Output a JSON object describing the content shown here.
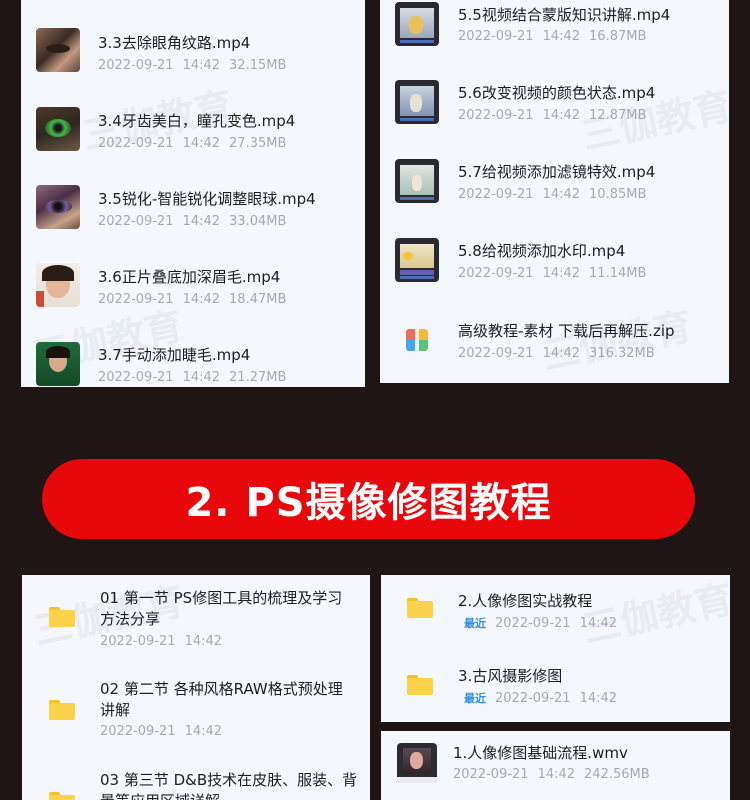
{
  "watermark": "三伽教育",
  "banner": {
    "title": "2. PS摄像修图教程"
  },
  "panel_tl": {
    "files": [
      {
        "name": "3.3去除眼角纹路.mp4",
        "date": "2022-09-21",
        "time": "14:42",
        "size": "32.15MB",
        "thumb": "eye-closeup"
      },
      {
        "name": "3.4牙齿美白，瞳孔变色.mp4",
        "date": "2022-09-21",
        "time": "14:42",
        "size": "27.35MB",
        "thumb": "green-eye"
      },
      {
        "name": "3.5锐化-智能锐化调整眼球.mp4",
        "date": "2022-09-21",
        "time": "14:42",
        "size": "33.04MB",
        "thumb": "purple-eye"
      },
      {
        "name": "3.6正片叠底加深眉毛.mp4",
        "date": "2022-09-21",
        "time": "14:42",
        "size": "18.47MB",
        "thumb": "portrait"
      },
      {
        "name": "3.7手动添加睫毛.mp4",
        "date": "2022-09-21",
        "time": "14:42",
        "size": "21.27MB",
        "thumb": "green-portrait"
      }
    ]
  },
  "panel_tr": {
    "files": [
      {
        "name": "5.5视频结合蒙版知识讲解.mp4",
        "date": "2022-09-21",
        "time": "14:42",
        "size": "16.87MB",
        "thumb": "video-editor"
      },
      {
        "name": "5.6改变视频的颜色状态.mp4",
        "date": "2022-09-21",
        "time": "14:42",
        "size": "12.87MB",
        "thumb": "video-editor"
      },
      {
        "name": "5.7给视频添加滤镜特效.mp4",
        "date": "2022-09-21",
        "time": "14:42",
        "size": "10.85MB",
        "thumb": "video-editor"
      },
      {
        "name": "5.8给视频添加水印.mp4",
        "date": "2022-09-21",
        "time": "14:42",
        "size": "11.14MB",
        "thumb": "video-editor"
      },
      {
        "name": "高级教程-素材 下载后再解压.zip",
        "date": "2022-09-21",
        "time": "14:42",
        "size": "316.32MB",
        "thumb": "zip-archive"
      }
    ]
  },
  "panel_bl": {
    "folders": [
      {
        "name_line1": "01 第一节 PS修图工具的梳理及学习",
        "name_line2": "方法分享",
        "date": "2022-09-21",
        "time": "14:42"
      },
      {
        "name_line1": "02 第二节 各种风格RAW格式预处理",
        "name_line2": "讲解",
        "date": "2022-09-21",
        "time": "14:42"
      },
      {
        "name_line1": "03 第三节 D&B技术在皮肤、服装、背",
        "name_line2": "景等应用区域详解",
        "date": "",
        "time": ""
      }
    ]
  },
  "panel_br1": {
    "folders": [
      {
        "name": "2.人像修图实战教程",
        "badge": "最近",
        "date": "2022-09-21",
        "time": "14:42"
      },
      {
        "name": "3.古风摄影修图",
        "badge": "最近",
        "date": "2022-09-21",
        "time": "14:42"
      }
    ]
  },
  "panel_br2": {
    "files": [
      {
        "name": "1.人像修图基础流程.wmv",
        "date": "2022-09-21",
        "time": "14:42",
        "size": "242.56MB",
        "thumb": "portrait-editor"
      }
    ]
  },
  "colors": {
    "banner": "#e8070a",
    "background": "#1f1515",
    "panel": "#f4f7fc",
    "folder": "#fbd34a",
    "recent_badge": "#2e8de6",
    "meta": "#a6a9ad"
  }
}
